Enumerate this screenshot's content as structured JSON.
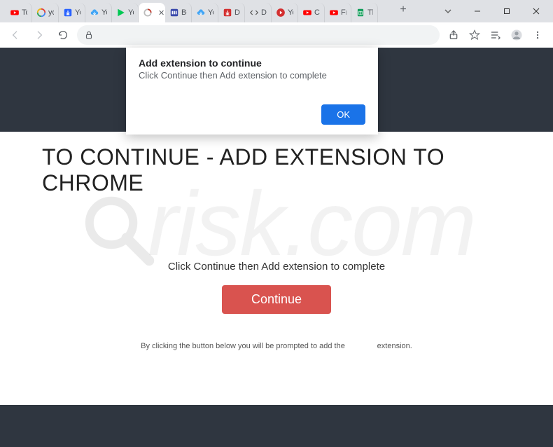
{
  "watermark": "risk.com",
  "browser": {
    "tabs": [
      {
        "title": "To",
        "favicon": "youtube"
      },
      {
        "title": "yo",
        "favicon": "google"
      },
      {
        "title": "Yo",
        "favicon": "dl-blue"
      },
      {
        "title": "Yo",
        "favicon": "cloud"
      },
      {
        "title": "Yo",
        "favicon": "play"
      },
      {
        "title": "",
        "favicon": "spinner",
        "active": true,
        "closeable": true
      },
      {
        "title": "Be",
        "favicon": "bars"
      },
      {
        "title": "Yo",
        "favicon": "cloud"
      },
      {
        "title": "Do",
        "favicon": "dl-red"
      },
      {
        "title": "Do",
        "favicon": "code"
      },
      {
        "title": "Yo",
        "favicon": "play-red"
      },
      {
        "title": "Co",
        "favicon": "yt-red"
      },
      {
        "title": "Fr",
        "favicon": "yt-red"
      },
      {
        "title": "Th",
        "favicon": "sheets"
      }
    ],
    "address": ""
  },
  "dialog": {
    "title": "Add extension to continue",
    "body": "Click Continue then Add extension to complete",
    "ok": "OK"
  },
  "page": {
    "heading": "TO CONTINUE - ADD EXTENSION TO CHROME",
    "instruction": "Click Continue then Add extension to complete",
    "continue": "Continue",
    "disclaimer_before": "By clicking the button below you will be prompted to add the",
    "disclaimer_after": "extension."
  }
}
